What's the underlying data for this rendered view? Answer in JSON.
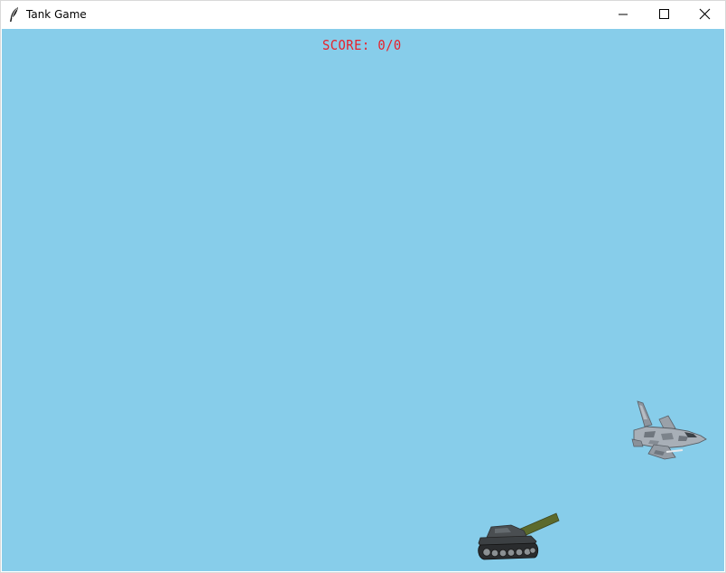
{
  "window": {
    "title": "Tank Game",
    "icons": {
      "app": "feather-icon",
      "minimize": "minimize-icon",
      "maximize": "maximize-icon",
      "close": "close-icon"
    }
  },
  "game": {
    "score_text": "SCORE: 0/0",
    "sky_color": "#87cdea",
    "score_color": "#e8202a",
    "sprites": {
      "enemy": "fighter-jet",
      "player": "tank"
    }
  }
}
